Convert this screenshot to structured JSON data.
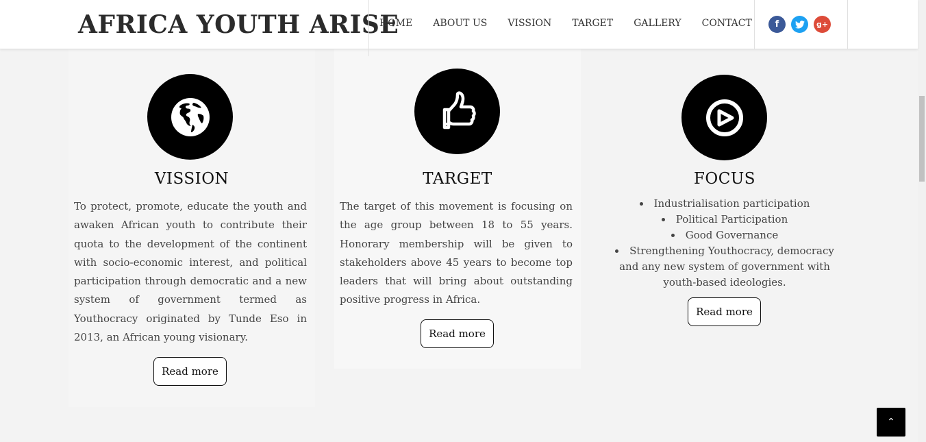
{
  "header": {
    "brand": "AFRICA YOUTH ARISE",
    "nav": [
      "HOME",
      "ABOUT US",
      "VISSION",
      "TARGET",
      "GALLERY",
      "CONTACT"
    ],
    "social": [
      {
        "name": "facebook-icon",
        "glyph": "f",
        "color": "#3b5998"
      },
      {
        "name": "twitter-icon",
        "glyph": "t",
        "color": "#1da1f2"
      },
      {
        "name": "google-plus-icon",
        "glyph": "g+",
        "color": "#dd4b39"
      }
    ]
  },
  "cards": [
    {
      "icon": "globe-icon",
      "title": "VISSION",
      "text": "To protect, promote, educate the youth and awaken African youth to contribute their quota to the development of the continent with socio-economic interest, and political participation through democratic and a new system of government termed as Youthocracy originated by Tunde Eso in 2013, an African young visionary.",
      "button": "Read more"
    },
    {
      "icon": "thumbs-up-icon",
      "title": "TARGET",
      "text": "The target of this movement is focusing on the age group between 18 to 55 years. Honorary membership will be given to stakeholders above 45 years to become top leaders that will bring about outstanding positive progress in Africa.",
      "button": "Read more"
    },
    {
      "icon": "compass-icon",
      "title": "FOCUS",
      "items": [
        "Industrialisation participation",
        "Political Participation",
        "Good Governance",
        "Strengthening Youthocracy, democracy and any new system of government with youth-based ideologies."
      ],
      "button": "Read more"
    }
  ],
  "back_to_top_icon": "chevron-up-icon",
  "back_to_top_glyph": "⌃"
}
